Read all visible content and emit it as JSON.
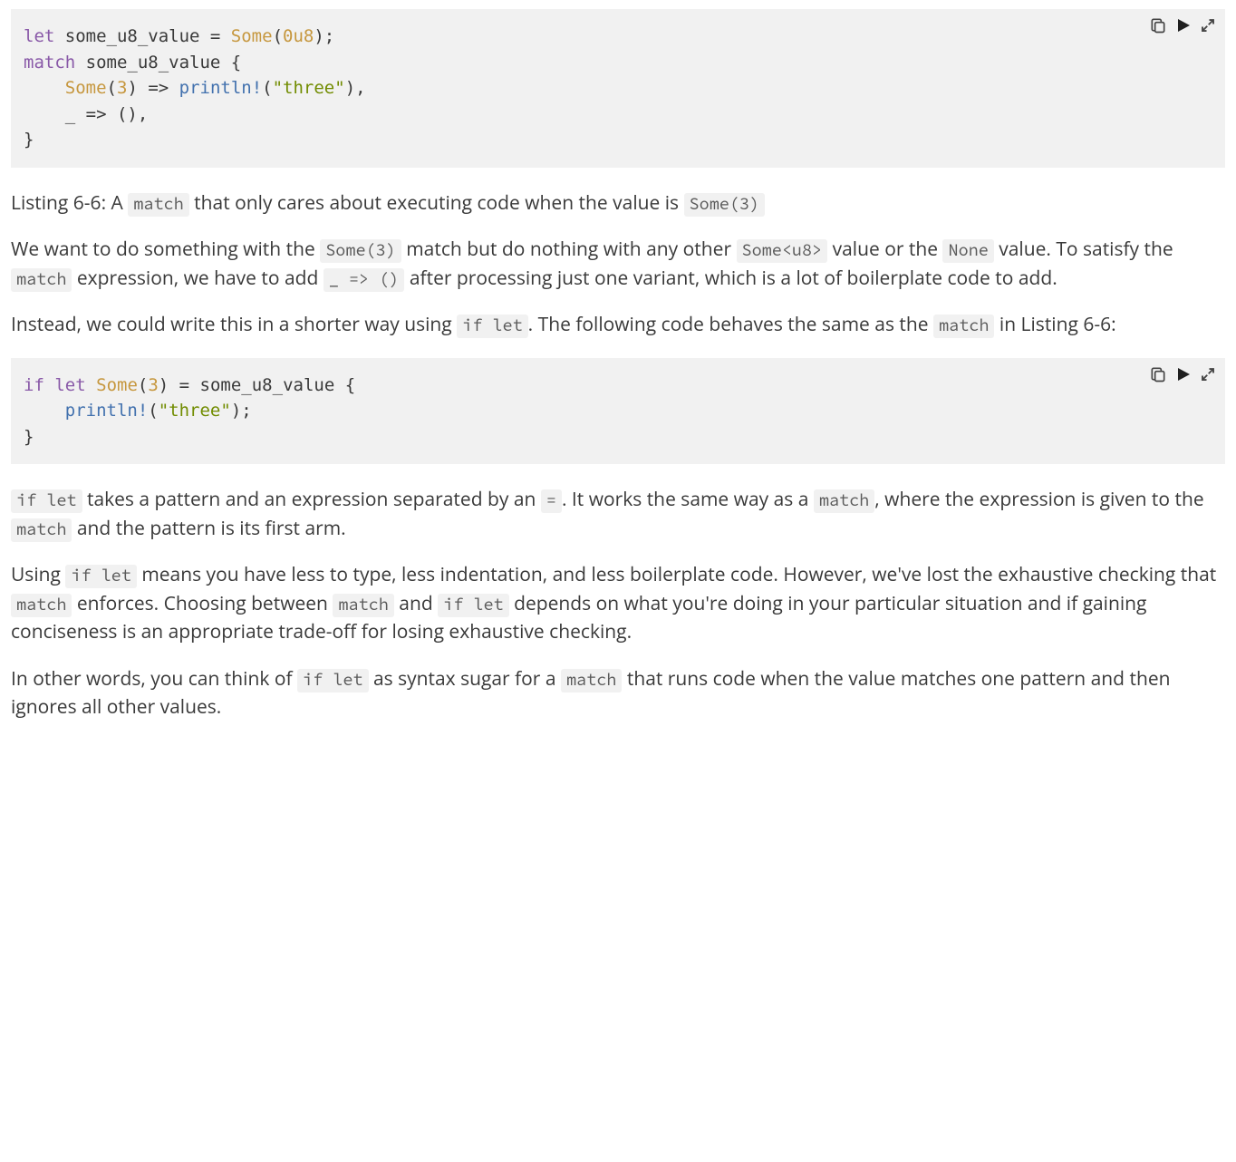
{
  "code1": {
    "tokens": [
      {
        "t": "let",
        "c": "kw"
      },
      {
        "t": " some_u8_value = ",
        "c": "pun"
      },
      {
        "t": "Some",
        "c": "ty"
      },
      {
        "t": "(",
        "c": "pun"
      },
      {
        "t": "0u8",
        "c": "num"
      },
      {
        "t": ");\n",
        "c": "pun"
      },
      {
        "t": "match",
        "c": "kw"
      },
      {
        "t": " some_u8_value {\n",
        "c": "pun"
      },
      {
        "t": "    ",
        "c": "pun"
      },
      {
        "t": "Some",
        "c": "ty"
      },
      {
        "t": "(",
        "c": "pun"
      },
      {
        "t": "3",
        "c": "num"
      },
      {
        "t": ") => ",
        "c": "pun"
      },
      {
        "t": "println!",
        "c": "call"
      },
      {
        "t": "(",
        "c": "pun"
      },
      {
        "t": "\"three\"",
        "c": "str"
      },
      {
        "t": "),\n",
        "c": "pun"
      },
      {
        "t": "    _ => (),\n",
        "c": "pun"
      },
      {
        "t": "}",
        "c": "pun"
      }
    ]
  },
  "caption1": {
    "pre": "Listing 6-6: A ",
    "c1": "match",
    "mid1": " that only cares about executing code when the value is ",
    "c2": "Some(3)"
  },
  "para1": {
    "t1": "We want to do something with the ",
    "c1": "Some(3)",
    "t2": " match but do nothing with any other ",
    "c2": "Some<u8>",
    "t3": " value or the ",
    "c3": "None",
    "t4": " value. To satisfy the ",
    "c4": "match",
    "t5": " expression, we have to add ",
    "c5": "_ => ()",
    "t6": " after processing just one variant, which is a lot of boilerplate code to add."
  },
  "para2": {
    "t1": "Instead, we could write this in a shorter way using ",
    "c1": "if let",
    "t2": ". The following code behaves the same as the ",
    "c2": "match",
    "t3": " in Listing 6-6:"
  },
  "code2": {
    "tokens": [
      {
        "t": "if",
        "c": "kw"
      },
      {
        "t": " ",
        "c": "pun"
      },
      {
        "t": "let",
        "c": "kw"
      },
      {
        "t": " ",
        "c": "pun"
      },
      {
        "t": "Some",
        "c": "ty"
      },
      {
        "t": "(",
        "c": "pun"
      },
      {
        "t": "3",
        "c": "num"
      },
      {
        "t": ") = some_u8_value {\n",
        "c": "pun"
      },
      {
        "t": "    ",
        "c": "pun"
      },
      {
        "t": "println!",
        "c": "call"
      },
      {
        "t": "(",
        "c": "pun"
      },
      {
        "t": "\"three\"",
        "c": "str"
      },
      {
        "t": ");\n",
        "c": "pun"
      },
      {
        "t": "}",
        "c": "pun"
      }
    ]
  },
  "para3": {
    "c1": "if let",
    "t1": " takes a pattern and an expression separated by an ",
    "c2": "=",
    "t2": ". It works the same way as a ",
    "c3": "match",
    "t3": ", where the expression is given to the ",
    "c4": "match",
    "t4": " and the pattern is its first arm."
  },
  "para4": {
    "t1": "Using ",
    "c1": "if let",
    "t2": " means you have less to type, less indentation, and less boilerplate code. However, we've lost the exhaustive checking that ",
    "c2": "match",
    "t3": " enforces. Choosing between ",
    "c3": "match",
    "t4": " and ",
    "c4": "if let",
    "t5": " depends on what you're doing in your particular situation and if gaining conciseness is an appropriate trade-off for losing exhaustive checking."
  },
  "para5": {
    "t1": "In other words, you can think of ",
    "c1": "if let",
    "t2": " as syntax sugar for a ",
    "c2": "match",
    "t3": " that runs code when the value matches one pattern and then ignores all other values."
  }
}
